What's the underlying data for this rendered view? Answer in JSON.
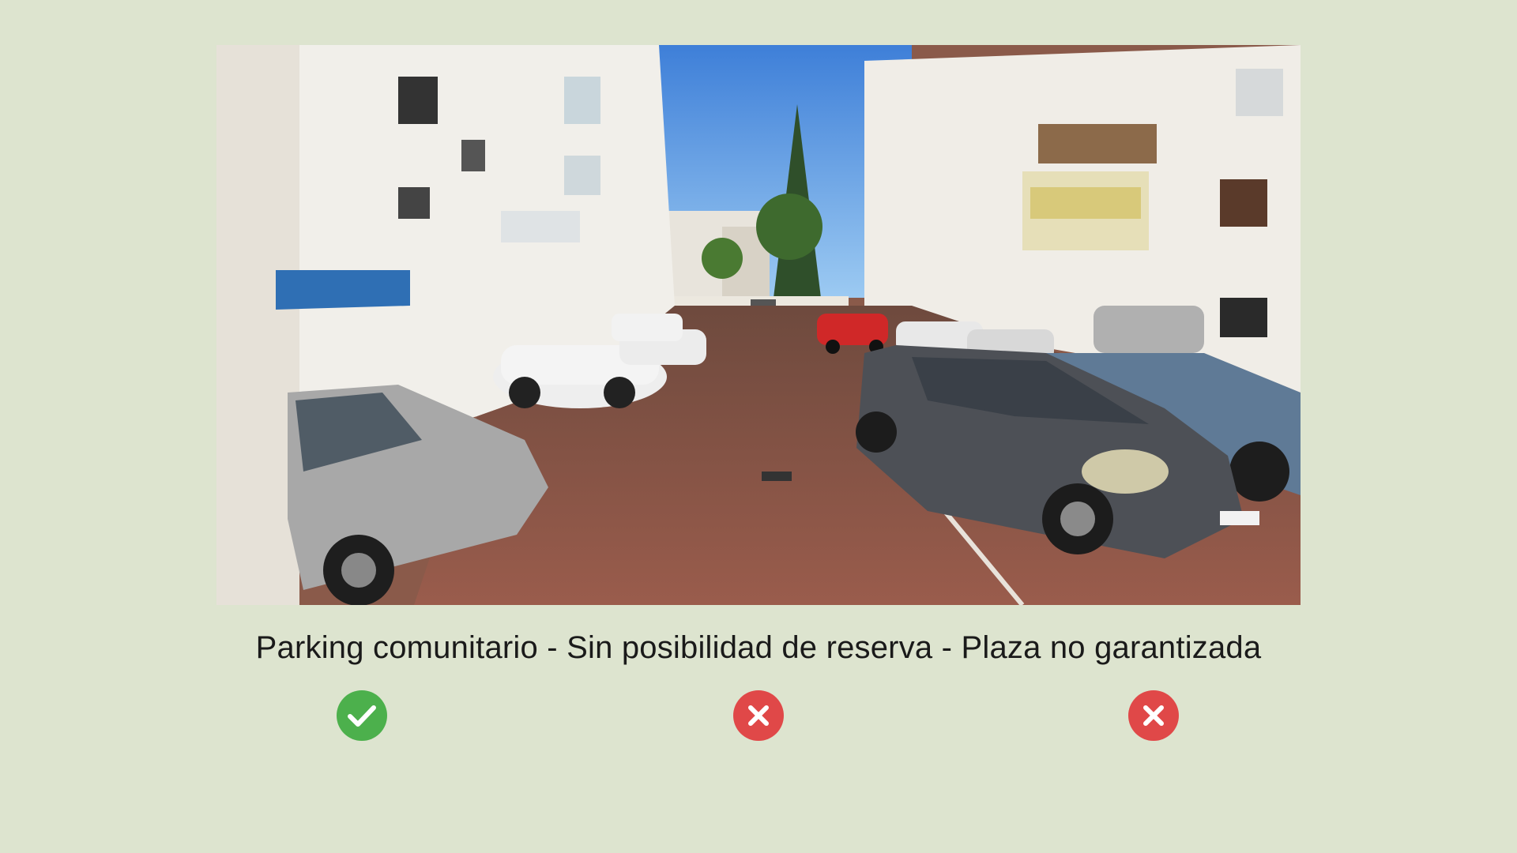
{
  "photo": {
    "subject": "parking-lot-courtyard"
  },
  "caption": "Parking comunitario - Sin posibilidad de reserva - Plaza no garantizada",
  "status_icons": [
    {
      "icon": "check-icon",
      "color": "#4cb04c"
    },
    {
      "icon": "x-icon",
      "color": "#e04848"
    },
    {
      "icon": "x-icon",
      "color": "#e04848"
    }
  ]
}
